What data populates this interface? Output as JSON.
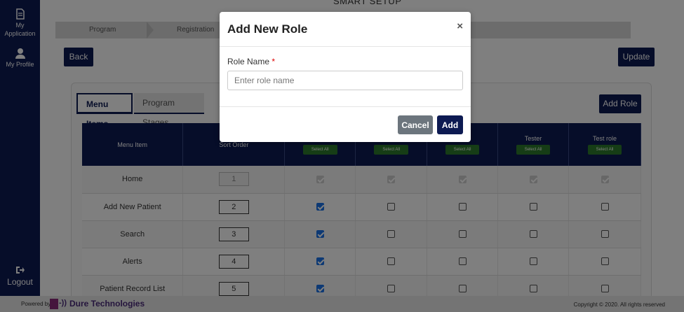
{
  "sidebar": {
    "items": [
      {
        "label": "My Application",
        "icon": "file-icon"
      },
      {
        "label": "My Profile",
        "icon": "user-icon"
      }
    ],
    "logout_label": "Logout"
  },
  "page": {
    "title": "SMART SETUP",
    "steps": [
      "Program",
      "Registration"
    ],
    "back_label": "Back",
    "update_label": "Update",
    "add_role_label": "Add Role",
    "tabs": [
      "Menu Items",
      "Program Stages"
    ]
  },
  "table": {
    "headers": [
      "Menu Item",
      "Sort Order",
      "",
      "",
      "",
      "Tester",
      "Test role"
    ],
    "select_all_label": "Select All",
    "rows": [
      {
        "item": "Home",
        "order": "1",
        "checks": [
          "dis",
          "dis",
          "dis",
          "dis",
          "dis"
        ]
      },
      {
        "item": "Add New Patient",
        "order": "2",
        "checks": [
          "on",
          "off",
          "off",
          "off",
          "off"
        ]
      },
      {
        "item": "Search",
        "order": "3",
        "checks": [
          "on",
          "off",
          "off",
          "off",
          "off"
        ]
      },
      {
        "item": "Alerts",
        "order": "4",
        "checks": [
          "on",
          "off",
          "off",
          "off",
          "off"
        ]
      },
      {
        "item": "Patient Record List",
        "order": "5",
        "checks": [
          "on",
          "off",
          "off",
          "off",
          "off"
        ]
      }
    ]
  },
  "modal": {
    "title": "Add New Role",
    "close_glyph": "×",
    "field_label": "Role Name",
    "required_mark": "*",
    "placeholder": "Enter role name",
    "value": "",
    "cancel_label": "Cancel",
    "add_label": "Add"
  },
  "footer": {
    "powered_by": "Powered by",
    "logo_glyph": "-))",
    "brand": "Dure Technologies",
    "copyright": "Copyright © 2020. All rights reserved"
  },
  "colors": {
    "primary": "#0d1a52",
    "select_all": "#2d7a2d",
    "cancel": "#6c757d",
    "required": "#dd0000"
  }
}
